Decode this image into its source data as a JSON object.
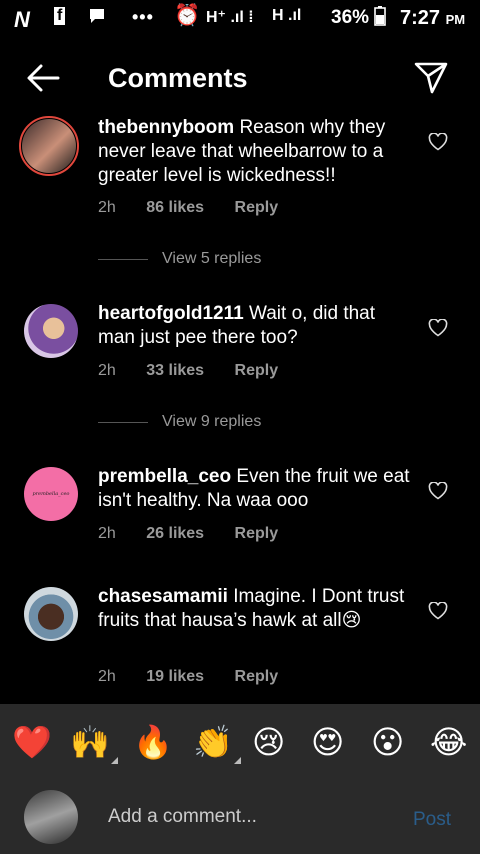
{
  "status_bar": {
    "carrier_logo": "N",
    "fb_icon": "f",
    "signal1": "H⁺ .ıl ⁞",
    "signal2": "H .ıl",
    "battery": "36%",
    "time": "7:27",
    "ampm": "PM"
  },
  "header": {
    "title": "Comments"
  },
  "comments": [
    {
      "user": "thebennyboom",
      "text": "Reason why they never leave that wheelbarrow to a greater level is wickedness!!",
      "time": "2h",
      "likes": "86 likes",
      "reply": "Reply",
      "view_replies": "View 5 replies"
    },
    {
      "user": "heartofgold1211",
      "text": "Wait o, did that man just pee there too?",
      "time": "2h",
      "likes": "33 likes",
      "reply": "Reply",
      "view_replies": "View 9 replies"
    },
    {
      "user": "prembella_ceo",
      "avatar_text": "prembella_ceo",
      "text": "Even the fruit we eat isn't healthy. Na waa ooo",
      "time": "2h",
      "likes": "26 likes",
      "reply": "Reply"
    },
    {
      "user": "chasesamamii",
      "text": "Imagine. I Dont trust fruits that hausa’s hawk at all😢",
      "time": "2h",
      "likes": "19 likes",
      "reply": "Reply"
    }
  ],
  "emojis": [
    "❤️",
    "🙌",
    "🔥",
    "👏",
    "😢",
    "😍",
    "😮",
    "😂"
  ],
  "composer": {
    "placeholder": "Add a comment...",
    "post_label": "Post"
  },
  "colors": {
    "background": "#000000",
    "muted_text": "#9a9a9a",
    "story_ring": "#e0473c",
    "post_link": "#2a5d8a",
    "bar_bg": "#2a2a2a"
  }
}
